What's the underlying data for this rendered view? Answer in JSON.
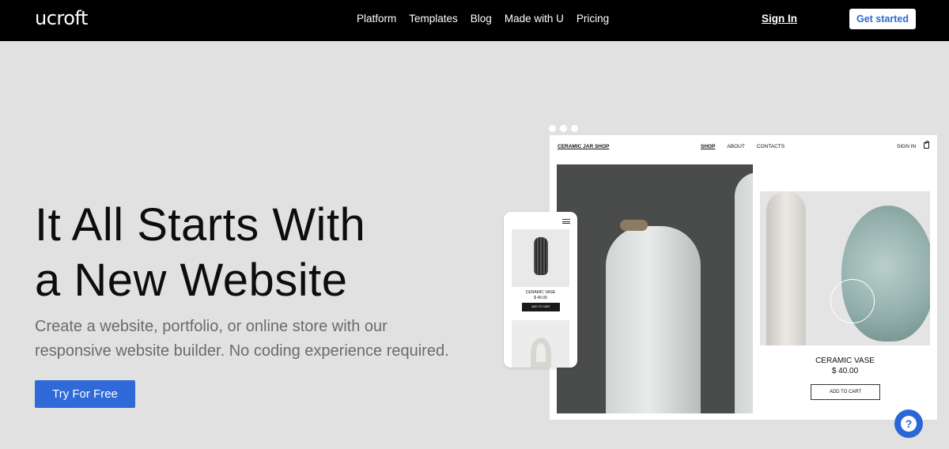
{
  "header": {
    "logo": "ucroft",
    "nav": [
      "Platform",
      "Templates",
      "Blog",
      "Made with U",
      "Pricing"
    ],
    "signin": "Sign In",
    "cta": "Get started"
  },
  "hero": {
    "title_line1": "It All Starts With",
    "title_line2": "a New Website",
    "subtitle_line1": "Create a website, portfolio, or online store with our",
    "subtitle_line2": "responsive website builder. No coding experience required.",
    "cta": "Try For Free"
  },
  "mockup": {
    "shop_logo": "CERAMIC JAR SHOP",
    "shop_nav": [
      "SHOP",
      "ABOUT",
      "CONTACTS"
    ],
    "shop_signin": "SIGN IN",
    "product_name": "CERAMIC VASE",
    "product_price": "$ 40.00",
    "add_to_cart": "ADD TO CART"
  },
  "phone": {
    "product_name": "CERAMIC VASE",
    "product_price": "$ 40.00",
    "add_to_cart": "ADD TO CART"
  },
  "help_icon_glyph": "?"
}
